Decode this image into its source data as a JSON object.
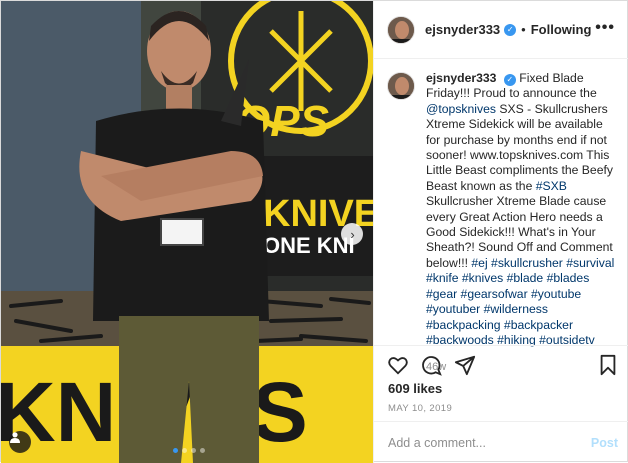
{
  "colors": {
    "accent": "#3897f0",
    "link": "#00376b",
    "muted": "#8e8e8e",
    "banner_yellow": "#f3d321"
  },
  "photo": {
    "banner_text_1": "OPS",
    "banner_text_2": "KNIVE",
    "banner_text_3": "ONE KNI",
    "banner_text_4": "KNIVES",
    "carousel_dots": 4,
    "active_dot_index": 0
  },
  "header": {
    "username": "ejsnyder333",
    "follow_status": "Following",
    "separator": "•",
    "more_icon": "more-horizontal-icon"
  },
  "caption": {
    "username": "ejsnyder333",
    "segments": [
      {
        "t": "Fixed Blade Friday!!! Proud to announce the "
      },
      {
        "t": "@topsknives",
        "link": true
      },
      {
        "t": " SXS - Skullcrushers Xtreme Sidekick will be available for purchase by months end if not sooner! www.topsknives.com This Little Beast compliments the Beefy Beast known as the "
      },
      {
        "t": "#SXB",
        "link": true
      },
      {
        "t": " Skullcrusher Xtreme Blade cause every Great Action Hero needs a Good Sidekick!!! What's in Your Sheath?! Sound Off and Comment below!!! "
      },
      {
        "t": "#ej #skullcrusher #survival #knife #knives #blade #blades #gear #gearsofwar #youtube #youtuber #wilderness #backpacking #backpacker #backwoods #hiking #outsidetv",
        "link": true
      }
    ],
    "time_ago": "46w"
  },
  "actions": {
    "like_icon": "heart-icon",
    "comment_icon": "comment-icon",
    "share_icon": "share-icon",
    "save_icon": "bookmark-icon"
  },
  "likes": "609 likes",
  "date": "MAY 10, 2019",
  "comment": {
    "placeholder": "Add a comment...",
    "post_label": "Post"
  }
}
